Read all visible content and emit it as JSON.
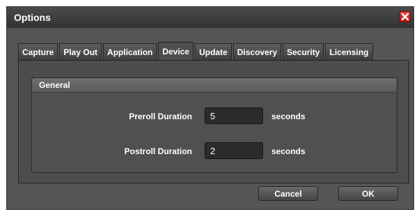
{
  "dialog": {
    "title": "Options",
    "close_icon": "close-icon",
    "close_color": "#d8201c"
  },
  "tabs": [
    {
      "label": "Capture",
      "active": false
    },
    {
      "label": "Play Out",
      "active": false
    },
    {
      "label": "Application",
      "active": false
    },
    {
      "label": "Device",
      "active": true
    },
    {
      "label": "Update",
      "active": false
    },
    {
      "label": "Discovery",
      "active": false
    },
    {
      "label": "Security",
      "active": false
    },
    {
      "label": "Licensing",
      "active": false
    }
  ],
  "general": {
    "title": "General",
    "preroll": {
      "label": "Preroll Duration",
      "value": "5",
      "unit": "seconds"
    },
    "postroll": {
      "label": "Postroll Duration",
      "value": "2",
      "unit": "seconds"
    }
  },
  "footer": {
    "cancel_label": "Cancel",
    "ok_label": "OK"
  }
}
